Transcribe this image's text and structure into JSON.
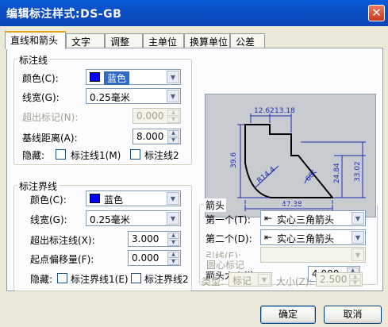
{
  "window": {
    "title": "编辑标注样式:DS-GB",
    "close_glyph": "✕"
  },
  "tabs": [
    {
      "label": "直线和箭头"
    },
    {
      "label": "文字"
    },
    {
      "label": "调整"
    },
    {
      "label": "主单位"
    },
    {
      "label": "换算单位"
    },
    {
      "label": "公差"
    }
  ],
  "dim_line": {
    "title": "标注线",
    "color_label": "颜色(C):",
    "color_value": "蓝色",
    "lineweight_label": "线宽(G):",
    "lineweight_value": "0.25毫米",
    "extend_label": "超出标记(N):",
    "extend_value": "0.000",
    "baseline_label": "基线距离(A):",
    "baseline_value": "8.000",
    "hide_label": "隐藏:",
    "hide1_label": "标注线1(M)",
    "hide2_label": "标注线2"
  },
  "ext_line": {
    "title": "标注界线",
    "color_label": "颜色(C):",
    "color_value": "蓝色",
    "lineweight_label": "线宽(G):",
    "lineweight_value": "0.25毫米",
    "extend_label": "超出标注线(X):",
    "extend_value": "3.000",
    "offset_label": "起点偏移量(F):",
    "offset_value": "0.000",
    "hide_label": "隐藏:",
    "hide1_label": "标注界线1(E)",
    "hide2_label": "标注界线2"
  },
  "arrows": {
    "title": "箭头",
    "first_label": "第一个(T):",
    "first_value": "实心三角箭头",
    "second_label": "第二个(D):",
    "second_value": "实心三角箭头",
    "leader_label": "引线(E):",
    "leader_value": "",
    "size_label": "箭头大小(I):",
    "size_value": "4.000"
  },
  "center": {
    "title": "圆心标记",
    "type_label": "类型:",
    "type_value": "标记",
    "size_label": "大小(Z):",
    "size_value": "2.500"
  },
  "preview": {
    "dim_top1": "12.62",
    "dim_top2": "13.18",
    "dim_left": "39.6",
    "dim_r1": "R14.4",
    "dim_angle": "60°",
    "dim_r2": "24.84",
    "dim_r3": "33.02",
    "dim_bottom": "47.38"
  },
  "buttons": {
    "ok": "确定",
    "cancel": "取消"
  },
  "colors": {
    "dim_line_color": "#0000ff",
    "ext_line_color": "#0000ff"
  }
}
